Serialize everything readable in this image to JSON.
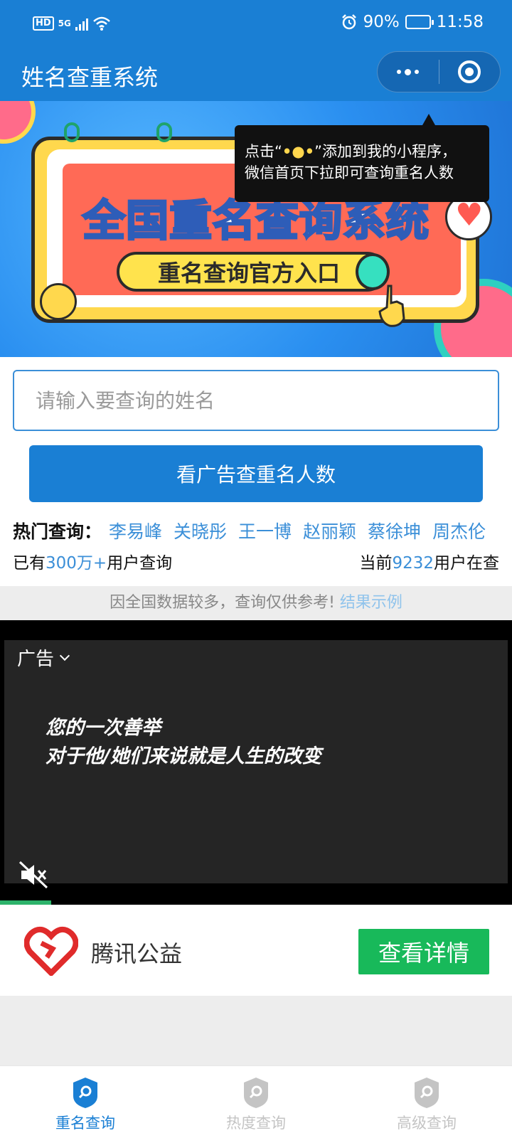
{
  "status_bar": {
    "hd": "HD",
    "network": "5G",
    "battery_percent_label": "90%",
    "battery_level": 0.9,
    "time": "11:58"
  },
  "header": {
    "title": "姓名查重系统"
  },
  "banner": {
    "headline": "全国重名查询系统",
    "subline": "重名查询官方入口",
    "tooltip": {
      "prefix": "点击“",
      "dots": "•●•",
      "suffix": "”添加到我的小程序，",
      "line2": "微信首页下拉即可查询重名人数"
    }
  },
  "search": {
    "placeholder": "请输入要查询的姓名",
    "value": "",
    "button_label": "看广告查重名人数"
  },
  "hot": {
    "label": "热门查询：",
    "names": [
      "李易峰",
      "关晓彤",
      "王一博",
      "赵丽颖",
      "蔡徐坤",
      "周杰伦"
    ]
  },
  "stats": {
    "users_prefix": "已有",
    "users_count": "300万+",
    "users_suffix": "用户查询",
    "online_prefix": "当前",
    "online_count": "9232",
    "online_suffix": "用户在查"
  },
  "disclaimer": {
    "text": "因全国数据较多，查询仅供参考!",
    "link": "结果示例"
  },
  "ad": {
    "label": "广告",
    "caption_line1": "您的一次善举",
    "caption_line2": "对于他/她们来说就是人生的改变",
    "progress": 0.1
  },
  "sponsor": {
    "name": "腾讯公益",
    "button_label": "查看详情"
  },
  "tabs": [
    {
      "label": "重名查询",
      "active": true
    },
    {
      "label": "热度查询",
      "active": false
    },
    {
      "label": "高级查询",
      "active": false
    }
  ],
  "colors": {
    "primary": "#1a7fd4",
    "link": "#3b8fd8",
    "cta_green": "#18b95a",
    "tab_inactive": "#c4c4c4"
  }
}
